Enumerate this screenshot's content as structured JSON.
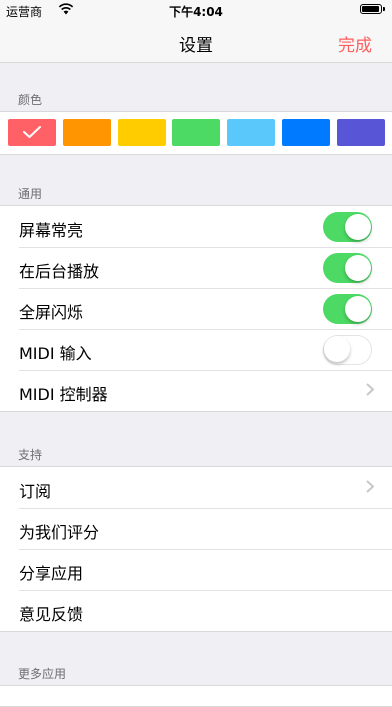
{
  "status_bar": {
    "carrier": "运营商",
    "time": "下午4:04"
  },
  "nav": {
    "title": "设置",
    "done_label": "完成"
  },
  "colors": {
    "header": "颜色",
    "swatches": [
      "#ff6166",
      "#ff9500",
      "#ffcc00",
      "#4cd964",
      "#5ac8fa",
      "#007aff",
      "#5856d6"
    ],
    "selected_index": 0
  },
  "general": {
    "header": "通用",
    "rows": [
      {
        "label": "屏幕常亮",
        "toggle": true
      },
      {
        "label": "在后台播放",
        "toggle": true
      },
      {
        "label": "全屏闪烁",
        "toggle": true
      },
      {
        "label": "MIDI 输入",
        "toggle": false
      },
      {
        "label": "MIDI 控制器",
        "disclosure": true
      }
    ]
  },
  "support": {
    "header": "支持",
    "rows": [
      {
        "label": "订阅",
        "disclosure": true
      },
      {
        "label": "为我们评分"
      },
      {
        "label": "分享应用"
      },
      {
        "label": "意见反馈"
      }
    ]
  },
  "more_apps": {
    "header": "更多应用"
  }
}
